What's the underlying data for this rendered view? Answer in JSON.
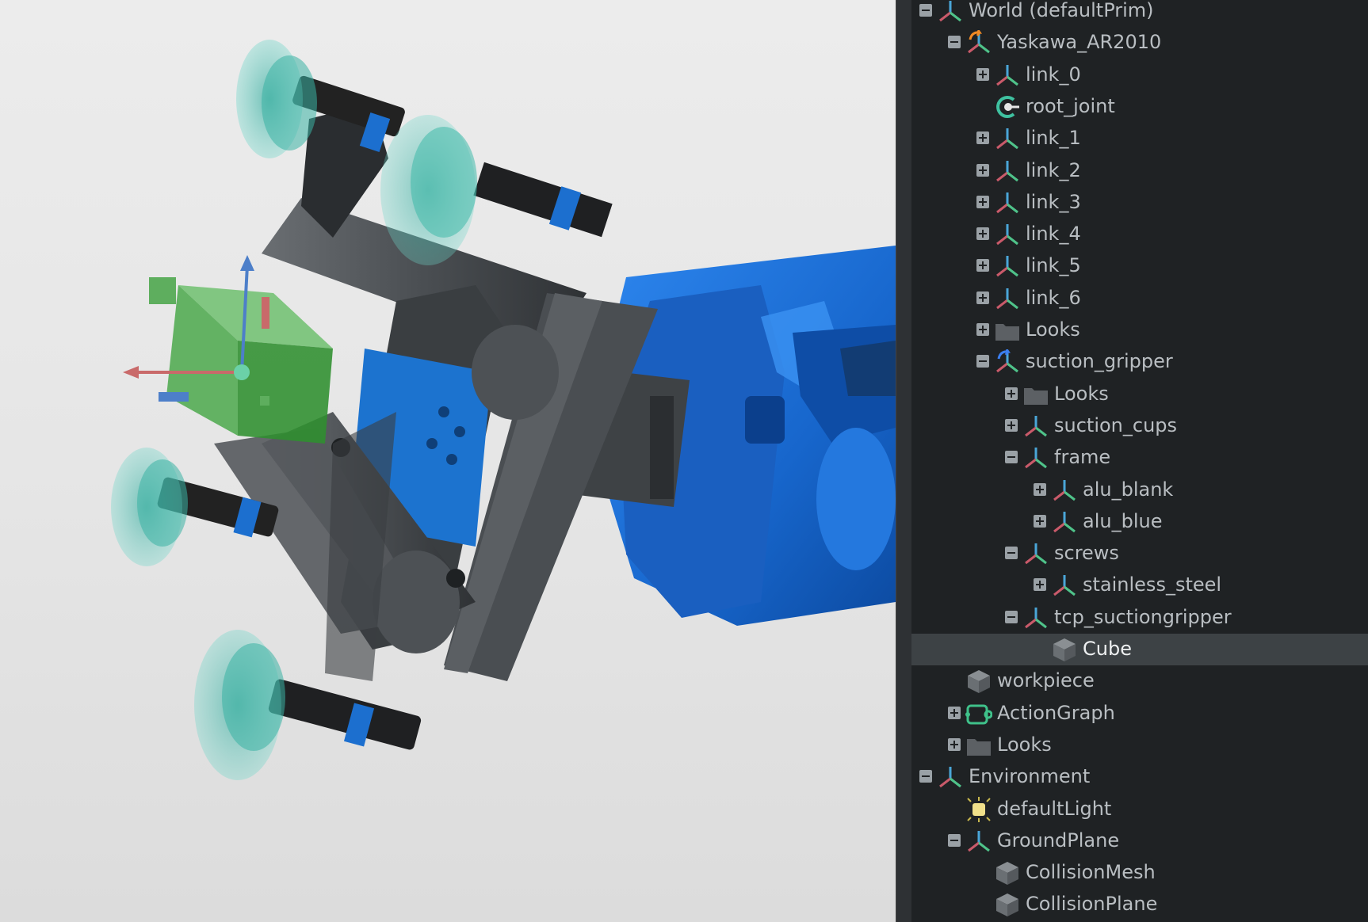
{
  "viewport": {
    "colors": {
      "robot_blue": "#1c6fd8",
      "cube_green": "#3aa83a",
      "suction_cup": "#4fc3b5",
      "frame_gray": "#55595d"
    }
  },
  "stage": {
    "colors": {
      "selected_bg": "#3d4245",
      "text": "#b9bec2",
      "panel_bg": "#1f2224"
    },
    "rows": [
      {
        "label": "World (defaultPrim)",
        "depth": 0,
        "expander": "minus",
        "icon": "xform-icon"
      },
      {
        "label": "Yaskawa_AR2010",
        "depth": 1,
        "expander": "minus",
        "icon": "xform-reference-icon"
      },
      {
        "label": "link_0",
        "depth": 2,
        "expander": "plus",
        "icon": "xform-icon"
      },
      {
        "label": "root_joint",
        "depth": 2,
        "expander": "none",
        "icon": "joint-icon"
      },
      {
        "label": "link_1",
        "depth": 2,
        "expander": "plus",
        "icon": "xform-icon"
      },
      {
        "label": "link_2",
        "depth": 2,
        "expander": "plus",
        "icon": "xform-icon"
      },
      {
        "label": "link_3",
        "depth": 2,
        "expander": "plus",
        "icon": "xform-icon"
      },
      {
        "label": "link_4",
        "depth": 2,
        "expander": "plus",
        "icon": "xform-icon"
      },
      {
        "label": "link_5",
        "depth": 2,
        "expander": "plus",
        "icon": "xform-icon"
      },
      {
        "label": "link_6",
        "depth": 2,
        "expander": "plus",
        "icon": "xform-icon"
      },
      {
        "label": "Looks",
        "depth": 2,
        "expander": "plus",
        "icon": "folder-icon"
      },
      {
        "label": "suction_gripper",
        "depth": 2,
        "expander": "minus",
        "icon": "xform-payload-icon"
      },
      {
        "label": "Looks",
        "depth": 3,
        "expander": "plus",
        "icon": "folder-icon"
      },
      {
        "label": "suction_cups",
        "depth": 3,
        "expander": "plus",
        "icon": "xform-icon"
      },
      {
        "label": "frame",
        "depth": 3,
        "expander": "minus",
        "icon": "xform-icon"
      },
      {
        "label": "alu_blank",
        "depth": 4,
        "expander": "plus",
        "icon": "xform-icon"
      },
      {
        "label": "alu_blue",
        "depth": 4,
        "expander": "plus",
        "icon": "xform-icon"
      },
      {
        "label": "screws",
        "depth": 3,
        "expander": "minus",
        "icon": "xform-icon"
      },
      {
        "label": "stainless_steel",
        "depth": 4,
        "expander": "plus",
        "icon": "xform-icon"
      },
      {
        "label": "tcp_suctiongripper",
        "depth": 3,
        "expander": "minus",
        "icon": "xform-icon"
      },
      {
        "label": "Cube",
        "depth": 4,
        "expander": "none",
        "icon": "cube-icon",
        "selected": true
      },
      {
        "label": "workpiece",
        "depth": 1,
        "expander": "none",
        "icon": "cube-icon"
      },
      {
        "label": "ActionGraph",
        "depth": 1,
        "expander": "plus",
        "icon": "action-graph-icon"
      },
      {
        "label": "Looks",
        "depth": 1,
        "expander": "plus",
        "icon": "folder-icon"
      },
      {
        "label": "Environment",
        "depth": 0,
        "expander": "minus",
        "icon": "xform-icon"
      },
      {
        "label": "defaultLight",
        "depth": 1,
        "expander": "none",
        "icon": "light-icon"
      },
      {
        "label": "GroundPlane",
        "depth": 1,
        "expander": "minus",
        "icon": "xform-icon"
      },
      {
        "label": "CollisionMesh",
        "depth": 2,
        "expander": "none",
        "icon": "cube-icon"
      },
      {
        "label": "CollisionPlane",
        "depth": 2,
        "expander": "none",
        "icon": "cube-icon"
      }
    ]
  }
}
